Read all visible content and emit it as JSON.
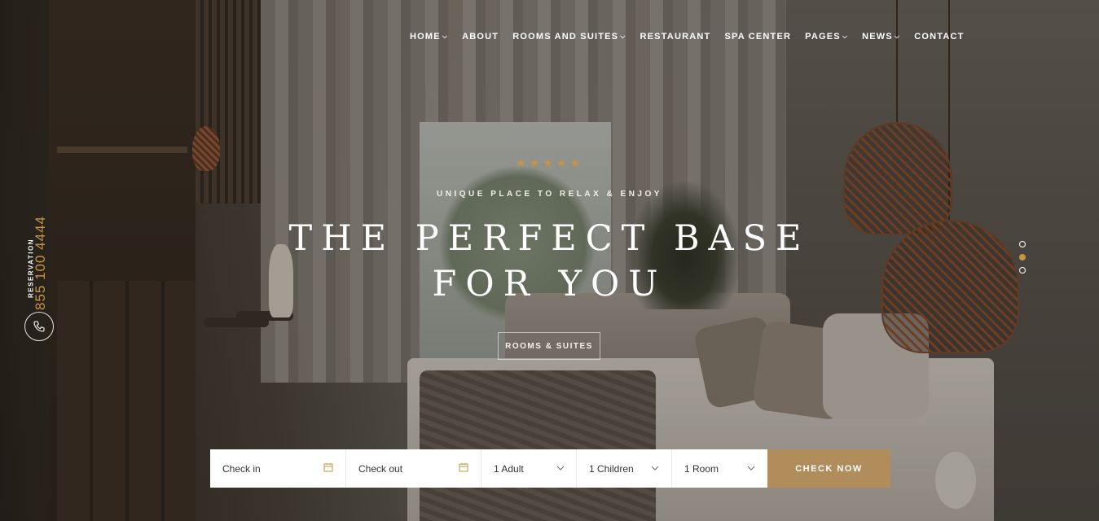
{
  "nav": {
    "items": [
      {
        "label": "HOME",
        "has_dropdown": true
      },
      {
        "label": "ABOUT",
        "has_dropdown": false
      },
      {
        "label": "ROOMS AND SUITES",
        "has_dropdown": true
      },
      {
        "label": "RESTAURANT",
        "has_dropdown": false
      },
      {
        "label": "SPA CENTER",
        "has_dropdown": false
      },
      {
        "label": "PAGES",
        "has_dropdown": true
      },
      {
        "label": "NEWS",
        "has_dropdown": true
      },
      {
        "label": "CONTACT",
        "has_dropdown": false
      }
    ],
    "dropdown_icon": "chevron-down-icon"
  },
  "hero": {
    "stars": "★★★★★",
    "star_count": 5,
    "tagline": "UNIQUE PLACE TO RELAX & ENJOY",
    "headline_line1": "THE PERFECT BASE",
    "headline_line2": "FOR YOU",
    "button_label": "ROOMS & SUITES"
  },
  "reservation": {
    "label": "RESERVATION",
    "phone": "855 100 4444",
    "icon": "phone-icon"
  },
  "slider": {
    "dot_count": 3,
    "active_index": 1
  },
  "booking": {
    "check_in": "Check in",
    "check_out": "Check out",
    "adults": "1 Adult",
    "children": "1 Children",
    "rooms": "1 Room",
    "button_label": "CHECK NOW",
    "calendar_icon": "calendar-icon",
    "select_icon": "chevron-down-icon"
  },
  "colors": {
    "accent": "#c8953f",
    "button_bg": "#b08d5b",
    "text_light": "#ffffff"
  }
}
